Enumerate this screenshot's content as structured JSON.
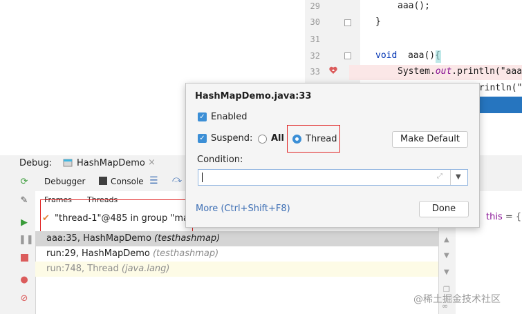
{
  "editor": {
    "line_numbers": [
      "29",
      "30",
      "31",
      "32",
      "33"
    ],
    "code_lines": [
      {
        "text": "aaa();"
      },
      {
        "text": "}"
      },
      {
        "text": ""
      },
      {
        "kw": "void",
        "text": "  aaa(){"
      },
      {
        "obj": "System.",
        "field": "out",
        "rest": ".println(\"aaa"
      },
      {
        "rest": "println(\"aaa"
      }
    ]
  },
  "popup": {
    "title": "HashMapDemo.java:33",
    "enabled_label": "Enabled",
    "suspend_label": "Suspend:",
    "all_label": "All",
    "thread_label": "Thread",
    "make_default_label": "Make Default",
    "condition_label": "Condition:",
    "condition_value": "",
    "more_link": "More (Ctrl+Shift+F8)",
    "done_label": "Done"
  },
  "debug": {
    "label": "Debug:",
    "session_tab": "HashMapDemo",
    "tab_debugger": "Debugger",
    "tab_console": "Console",
    "frames_label": "Frames",
    "threads_label": "Threads",
    "thread_selector": "\"thread-1\"@485 in group \"ma",
    "frames": [
      {
        "method": "aaa:35, HashMapDemo",
        "pkg": "(testhashmap)"
      },
      {
        "method": "run:29, HashMapDemo",
        "pkg": "(testhashmap)"
      },
      {
        "method": "run:748, Thread",
        "pkg": "(java.lang)"
      }
    ],
    "variables_partial": "this = {H"
  },
  "watermark": "@稀土掘金技术社区",
  "colors": {
    "selection": "#d5d5d5",
    "accent": "#3c8fd6",
    "breakpoint": "#db5c5c",
    "highlight_line": "#fbe7e7",
    "redbox": "#e02020"
  }
}
